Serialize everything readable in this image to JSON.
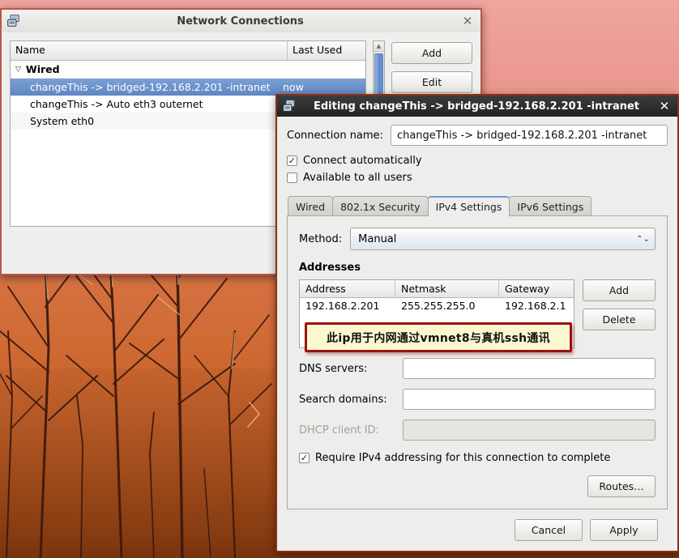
{
  "desktop": {
    "name": "ubuntu-orange-branches-wallpaper"
  },
  "netconn_window": {
    "title": "Network Connections",
    "icon": "network-connections-icon",
    "close_label": "✕",
    "columns": {
      "name": "Name",
      "last_used": "Last Used"
    },
    "groups": [
      {
        "label": "Wired",
        "expander": "▽",
        "rows": [
          {
            "name": "changeThis -> bridged-192.168.2.201 -intranet",
            "last_used": "now",
            "selected": true
          },
          {
            "name": "changeThis -> Auto eth3 outernet",
            "last_used": "",
            "selected": false
          },
          {
            "name": "System eth0",
            "last_used": "",
            "selected": false
          }
        ]
      }
    ],
    "buttons": {
      "add": "Add",
      "edit": "Edit"
    }
  },
  "edit_dialog": {
    "title": "Editing changeThis -> bridged-192.168.2.201 -intranet",
    "icon": "network-connections-icon",
    "close_label": "✕",
    "connection_name_label": "Connection name:",
    "connection_name_value": "changeThis -> bridged-192.168.2.201 -intranet",
    "connect_automatically": {
      "label": "Connect automatically",
      "checked": true,
      "mark": "✓"
    },
    "available_all_users": {
      "label": "Available to all users",
      "checked": false,
      "mark": "✓"
    },
    "tabs": [
      {
        "label": "Wired",
        "active": false
      },
      {
        "label": "802.1x Security",
        "active": false
      },
      {
        "label": "IPv4 Settings",
        "active": true
      },
      {
        "label": "IPv6 Settings",
        "active": false
      }
    ],
    "ipv4": {
      "method_label": "Method:",
      "method_value": "Manual",
      "method_spin": "⌃⌄",
      "addresses_title": "Addresses",
      "table_columns": {
        "address": "Address",
        "netmask": "Netmask",
        "gateway": "Gateway"
      },
      "table_rows": [
        {
          "address": "192.168.2.201",
          "netmask": "255.255.255.0",
          "gateway": "192.168.2.1"
        }
      ],
      "table_buttons": {
        "add": "Add",
        "delete": "Delete"
      },
      "annotation": {
        "text": "此ip用于内网通过vmnet8与真机ssh通讯",
        "border_color": "#9e1111",
        "background_color": "#fbf8cf"
      },
      "dns_servers_label": "DNS servers:",
      "dns_servers_value": "",
      "search_domains_label": "Search domains:",
      "search_domains_value": "",
      "dhcp_client_id_label": "DHCP client ID:",
      "dhcp_client_id_value": "",
      "require_ipv4": {
        "label": "Require IPv4 addressing for this connection to complete",
        "checked": true,
        "mark": "✓"
      },
      "routes_button": "Routes…"
    },
    "actions": {
      "cancel": "Cancel",
      "apply": "Apply"
    }
  }
}
